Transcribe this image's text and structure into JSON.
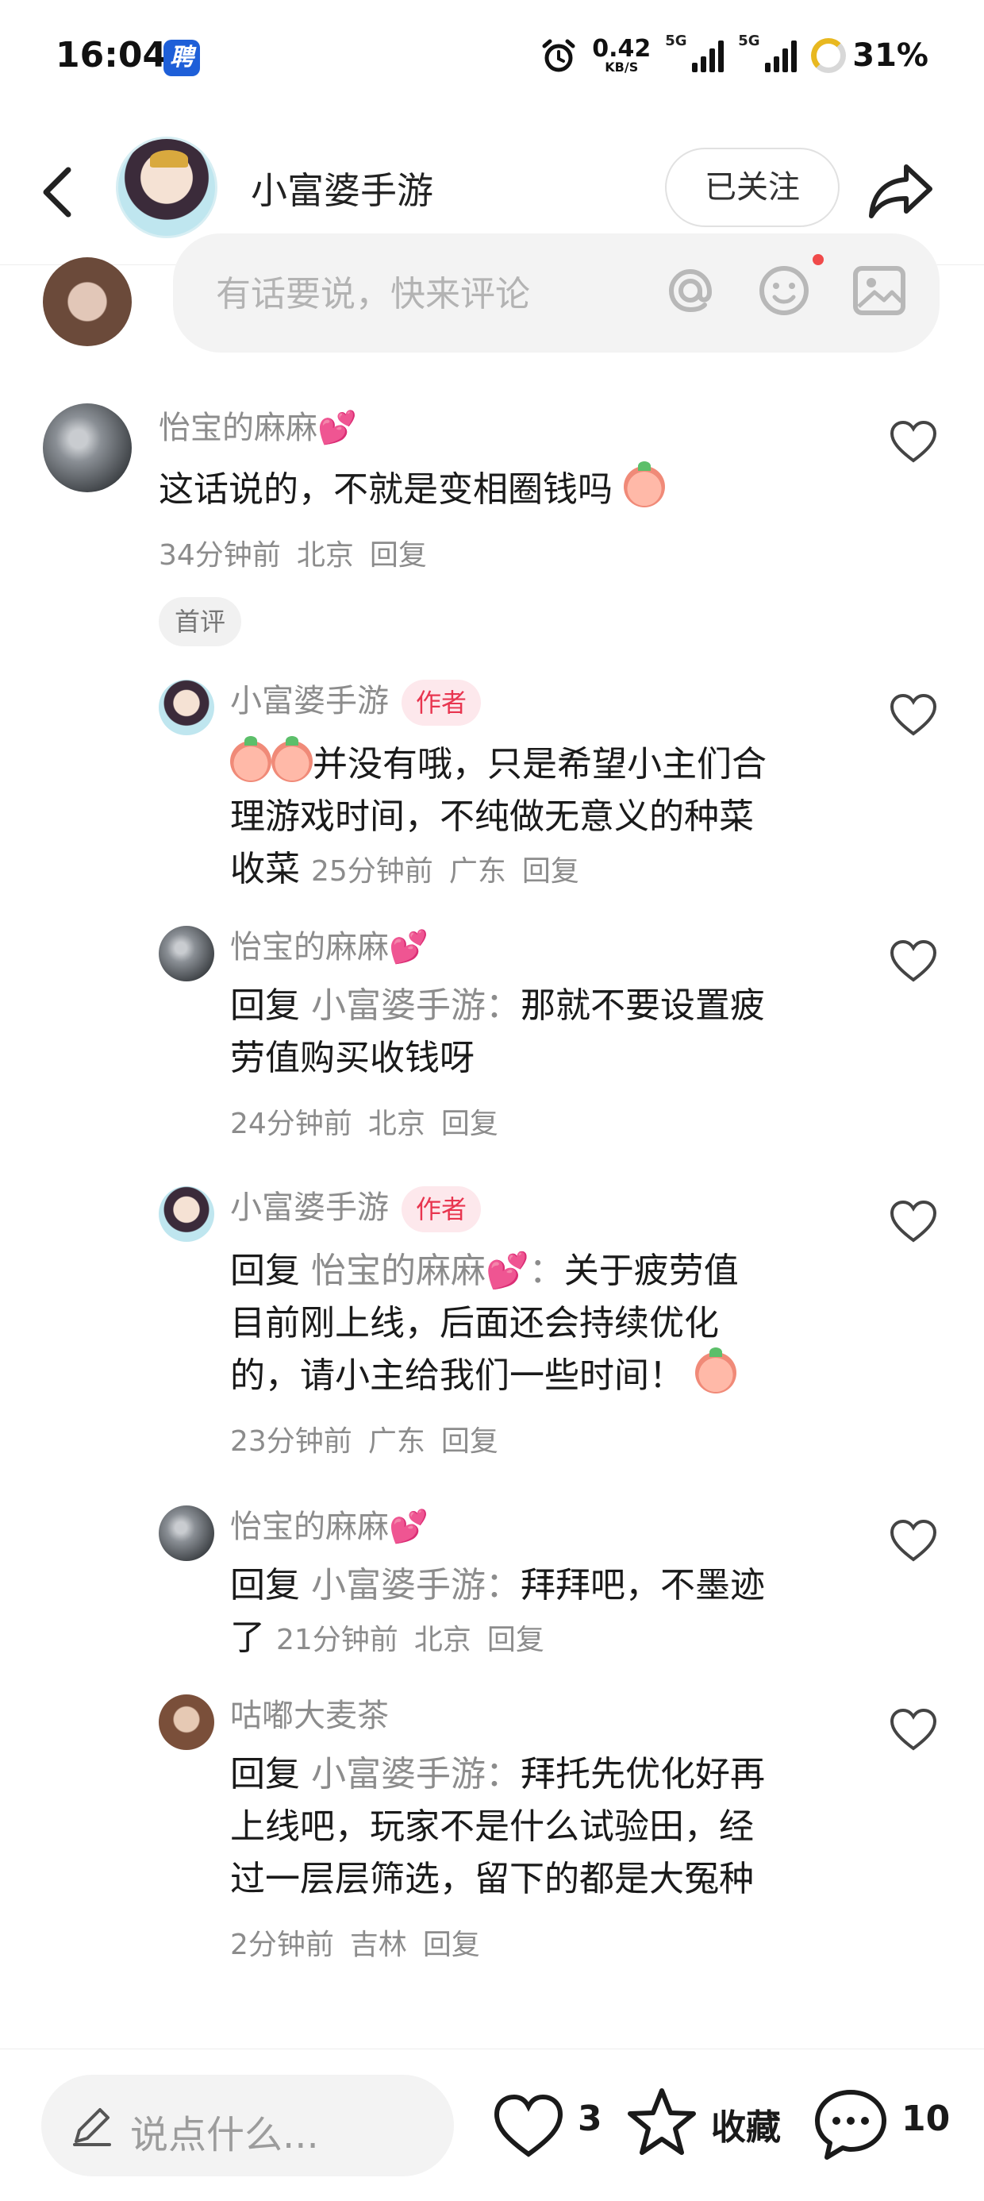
{
  "status_bar": {
    "time": "16:04",
    "app_badge": "聘",
    "net_speed_value": "0.42",
    "net_speed_unit": "KB/S",
    "signal1_label": "5G",
    "signal2_label": "5G",
    "battery": "31%"
  },
  "header": {
    "title": "小富婆手游",
    "follow_label": "已关注"
  },
  "comment_input": {
    "placeholder": "有话要说，快来评论"
  },
  "comments": [
    {
      "name": "怡宝的麻麻",
      "name_emoji": "💕",
      "text": "这话说的，不就是变相圈钱吗",
      "time": "34分钟前",
      "location": "北京",
      "reply_label": "回复",
      "badge": "首评"
    },
    {
      "name": "小富婆手游",
      "author_badge": "作者",
      "text_lines": [
        "并没有哦，只是希望小主们合",
        "理游戏时间，不纯做无意义的种菜",
        "收菜"
      ],
      "time": "25分钟前",
      "location": "广东",
      "reply_label": "回复"
    },
    {
      "name": "怡宝的麻麻",
      "name_emoji": "💕",
      "reply_prefix": "回复",
      "reply_target": "小富婆手游：",
      "text_lines": [
        "那就不要设置疲",
        "劳值购买收钱呀"
      ],
      "time": "24分钟前",
      "location": "北京",
      "reply_label": "回复"
    },
    {
      "name": "小富婆手游",
      "author_badge": "作者",
      "reply_prefix": "回复",
      "reply_target": "怡宝的麻麻💕：",
      "text_lines": [
        "关于疲劳值",
        "目前刚上线，后面还会持续优化",
        "的，请小主给我们一些时间！"
      ],
      "time": "23分钟前",
      "location": "广东",
      "reply_label": "回复"
    },
    {
      "name": "怡宝的麻麻",
      "name_emoji": "💕",
      "reply_prefix": "回复",
      "reply_target": "小富婆手游：",
      "text_lines": [
        "拜拜吧，不墨迹",
        "了"
      ],
      "time": "21分钟前",
      "location": "北京",
      "reply_label": "回复"
    },
    {
      "name": "咕嘟大麦茶",
      "reply_prefix": "回复",
      "reply_target": "小富婆手游：",
      "text_lines": [
        "拜托先优化好再",
        "上线吧，玩家不是什么试验田，经",
        "过一层层筛选，留下的都是大冤种"
      ],
      "time": "2分钟前",
      "location": "吉林",
      "reply_label": "回复"
    }
  ],
  "bottom_bar": {
    "placeholder": "说点什么...",
    "like_count": "3",
    "favorite_label": "收藏",
    "comment_count": "10"
  },
  "colors": {
    "author_badge_bg": "#fde8ec",
    "author_badge_text": "#e8354f",
    "secondary_text": "#8c8c8c",
    "heart_emoji": "#ef4b8b"
  }
}
